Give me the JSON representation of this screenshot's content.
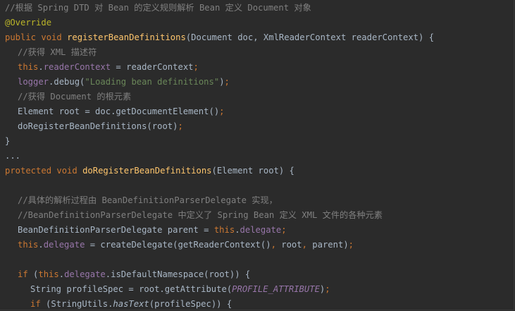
{
  "code": {
    "lines": [
      {
        "indent": 0,
        "tokens": [
          {
            "t": "comment",
            "v": "//根据 Spring DTD 对 Bean 的定义规则解析 Bean 定义 Document 对象"
          }
        ]
      },
      {
        "indent": 0,
        "tokens": [
          {
            "t": "annotation",
            "v": "@Override"
          }
        ]
      },
      {
        "indent": 0,
        "tokens": [
          {
            "t": "keyword",
            "v": "public void "
          },
          {
            "t": "method",
            "v": "registerBeanDefinitions"
          },
          {
            "t": "plain",
            "v": "(Document doc, XmlReaderContext readerContext) {"
          }
        ]
      },
      {
        "indent": 1,
        "tokens": [
          {
            "t": "comment",
            "v": "//获得 XML 描述符"
          }
        ]
      },
      {
        "indent": 1,
        "tokens": [
          {
            "t": "keyword",
            "v": "this"
          },
          {
            "t": "plain",
            "v": "."
          },
          {
            "t": "field",
            "v": "readerContext"
          },
          {
            "t": "plain",
            "v": " = readerContext"
          },
          {
            "t": "keyword",
            "v": ";"
          }
        ]
      },
      {
        "indent": 1,
        "tokens": [
          {
            "t": "field",
            "v": "logger"
          },
          {
            "t": "plain",
            "v": ".debug("
          },
          {
            "t": "string",
            "v": "\"Loading bean definitions\""
          },
          {
            "t": "plain",
            "v": ")"
          },
          {
            "t": "keyword",
            "v": ";"
          }
        ]
      },
      {
        "indent": 1,
        "tokens": [
          {
            "t": "comment",
            "v": "//获得 Document 的根元素"
          }
        ]
      },
      {
        "indent": 1,
        "tokens": [
          {
            "t": "plain",
            "v": "Element root = doc.getDocumentElement()"
          },
          {
            "t": "keyword",
            "v": ";"
          }
        ]
      },
      {
        "indent": 1,
        "tokens": [
          {
            "t": "plain",
            "v": "doRegisterBeanDefinitions(root)"
          },
          {
            "t": "keyword",
            "v": ";"
          }
        ]
      },
      {
        "indent": 0,
        "tokens": [
          {
            "t": "plain",
            "v": "}"
          }
        ]
      },
      {
        "indent": 0,
        "tokens": [
          {
            "t": "plain",
            "v": "..."
          }
        ]
      },
      {
        "indent": 0,
        "tokens": [
          {
            "t": "keyword",
            "v": "protected void "
          },
          {
            "t": "method",
            "v": "doRegisterBeanDefinitions"
          },
          {
            "t": "plain",
            "v": "(Element root) {"
          }
        ]
      },
      {
        "indent": 0,
        "tokens": []
      },
      {
        "indent": 1,
        "tokens": [
          {
            "t": "comment",
            "v": "//具体的解析过程由 BeanDefinitionParserDelegate 实现，"
          }
        ]
      },
      {
        "indent": 1,
        "tokens": [
          {
            "t": "comment",
            "v": "//BeanDefinitionParserDelegate 中定义了 Spring Bean 定义 XML 文件的各种元素"
          }
        ]
      },
      {
        "indent": 1,
        "tokens": [
          {
            "t": "plain",
            "v": "BeanDefinitionParserDelegate parent = "
          },
          {
            "t": "keyword",
            "v": "this"
          },
          {
            "t": "plain",
            "v": "."
          },
          {
            "t": "field",
            "v": "delegate"
          },
          {
            "t": "keyword",
            "v": ";"
          }
        ]
      },
      {
        "indent": 1,
        "tokens": [
          {
            "t": "keyword",
            "v": "this"
          },
          {
            "t": "plain",
            "v": "."
          },
          {
            "t": "field",
            "v": "delegate"
          },
          {
            "t": "plain",
            "v": " = createDelegate(getReaderContext()"
          },
          {
            "t": "keyword",
            "v": ", "
          },
          {
            "t": "plain",
            "v": "root"
          },
          {
            "t": "keyword",
            "v": ", "
          },
          {
            "t": "plain",
            "v": "parent)"
          },
          {
            "t": "keyword",
            "v": ";"
          }
        ]
      },
      {
        "indent": 0,
        "tokens": []
      },
      {
        "indent": 1,
        "tokens": [
          {
            "t": "keyword",
            "v": "if "
          },
          {
            "t": "plain",
            "v": "("
          },
          {
            "t": "keyword",
            "v": "this"
          },
          {
            "t": "plain",
            "v": "."
          },
          {
            "t": "field",
            "v": "delegate"
          },
          {
            "t": "plain",
            "v": ".isDefaultNamespace(root)) {"
          }
        ]
      },
      {
        "indent": 2,
        "tokens": [
          {
            "t": "plain",
            "v": "String profileSpec = root.getAttribute("
          },
          {
            "t": "const",
            "v": "PROFILE_ATTRIBUTE"
          },
          {
            "t": "plain",
            "v": ")"
          },
          {
            "t": "keyword",
            "v": ";"
          }
        ]
      },
      {
        "indent": 2,
        "tokens": [
          {
            "t": "keyword",
            "v": "if "
          },
          {
            "t": "plain",
            "v": "(StringUtils."
          },
          {
            "t": "italic",
            "v": "hasText"
          },
          {
            "t": "plain",
            "v": "(profileSpec)) {"
          }
        ]
      }
    ]
  }
}
